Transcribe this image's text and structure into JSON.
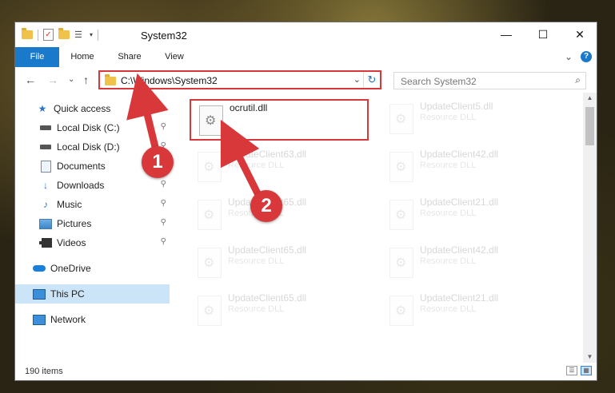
{
  "window": {
    "title": "System32",
    "controls": {
      "minimize": "—",
      "maximize": "☐",
      "close": "✕"
    }
  },
  "ribbon": {
    "tabs": [
      {
        "label": "File"
      },
      {
        "label": "Home"
      },
      {
        "label": "Share"
      },
      {
        "label": "View"
      }
    ],
    "collapse_glyph": "⌄",
    "help_glyph": "?"
  },
  "nav": {
    "back": "←",
    "forward": "→",
    "recent": "⌄",
    "up": "↑"
  },
  "address": {
    "path": "C:\\Windows\\System32",
    "chevron": "⌄",
    "refresh": "↻"
  },
  "search": {
    "placeholder": "Search System32",
    "icon": "⌕"
  },
  "sidebar": {
    "items": [
      {
        "label": "Quick access",
        "icon": "star-icon",
        "pinned": false
      },
      {
        "label": "Local Disk (C:)",
        "icon": "drive-icon",
        "pinned": true
      },
      {
        "label": "Local Disk (D:)",
        "icon": "drive-icon",
        "pinned": true
      },
      {
        "label": "Documents",
        "icon": "document-icon",
        "pinned": true
      },
      {
        "label": "Downloads",
        "icon": "download-icon",
        "pinned": true
      },
      {
        "label": "Music",
        "icon": "music-icon",
        "pinned": true
      },
      {
        "label": "Pictures",
        "icon": "pictures-icon",
        "pinned": true
      },
      {
        "label": "Videos",
        "icon": "video-icon",
        "pinned": true
      },
      {
        "label": "OneDrive",
        "icon": "cloud-icon",
        "pinned": false
      },
      {
        "label": "This PC",
        "icon": "computer-icon",
        "pinned": false,
        "selected": true
      },
      {
        "label": "Network",
        "icon": "network-icon",
        "pinned": false
      }
    ],
    "pin_glyph": "📌"
  },
  "files": {
    "left": [
      {
        "name": "ocrutil.dll",
        "type": "",
        "highlighted": true
      },
      {
        "name": "UpdateClient63.dll",
        "type": "Resource DLL"
      },
      {
        "name": "UpdateClient65.dll",
        "type": "Resource DLL"
      },
      {
        "name": "UpdateClient65.dll",
        "type": "Resource DLL"
      },
      {
        "name": "UpdateClient65.dll",
        "type": "Resource DLL"
      }
    ],
    "right": [
      {
        "name": "UpdateClient5.dll",
        "type": "Resource DLL"
      },
      {
        "name": "UpdateClient42.dll",
        "type": "Resource DLL"
      },
      {
        "name": "UpdateClient21.dll",
        "type": "Resource DLL"
      },
      {
        "name": "UpdateClient42.dll",
        "type": "Resource DLL"
      },
      {
        "name": "UpdateClient21.dll",
        "type": "Resource DLL"
      }
    ]
  },
  "status": {
    "item_count": "190 items"
  },
  "annotations": {
    "step1": "1",
    "step2": "2",
    "color": "#d8383a"
  },
  "colors": {
    "accent": "#1979ca",
    "highlight": "#d8383a",
    "selection": "#cce4f7"
  }
}
